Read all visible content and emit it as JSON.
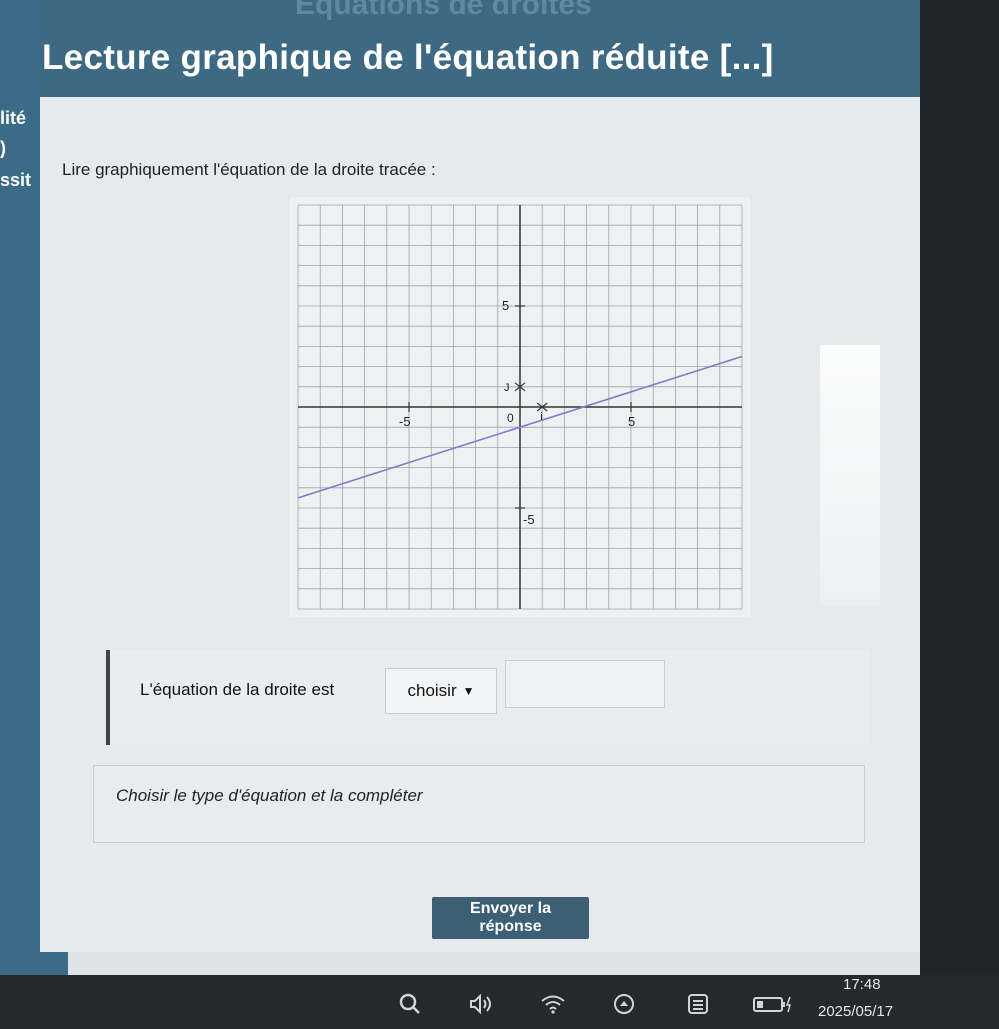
{
  "header": {
    "faded_title": "Equations de droites",
    "title": "Lecture graphique de l'équation réduite [...]"
  },
  "sidebar": {
    "fragments": [
      "lité",
      ")",
      "ssit"
    ]
  },
  "question": {
    "prompt": "Lire graphiquement l'équation de la droite tracée :"
  },
  "graph": {
    "tick_labels": {
      "x_neg": "-5",
      "x_pos": "5",
      "y_pos": "5",
      "y_neg": "-5",
      "origin": "0",
      "i_label": "i",
      "j_label": "J"
    },
    "line_color": "#7a80c8"
  },
  "chart_data": {
    "type": "line",
    "xlim": [
      -10,
      10
    ],
    "ylim": [
      -10,
      10
    ],
    "grid": true,
    "series": [
      {
        "x": [
          -10,
          10
        ],
        "y": [
          -4.5,
          2.5
        ]
      }
    ]
  },
  "answer": {
    "label": "L'équation de la droite est",
    "select_value": "choisir",
    "input_value": ""
  },
  "hint": {
    "text": "Choisir le type d'équation et la compléter"
  },
  "actions": {
    "submit_label": "Envoyer la réponse"
  },
  "taskbar": {
    "time": "17:48",
    "date": "2025/05/17",
    "icons": [
      "search-icon",
      "speaker-icon",
      "wifi-icon",
      "up-arrow-icon",
      "menu-icon",
      "battery-icon"
    ]
  },
  "colors": {
    "banner": "#3d6a82",
    "button": "#3c5f76",
    "sidebar": "#3b6b86"
  }
}
